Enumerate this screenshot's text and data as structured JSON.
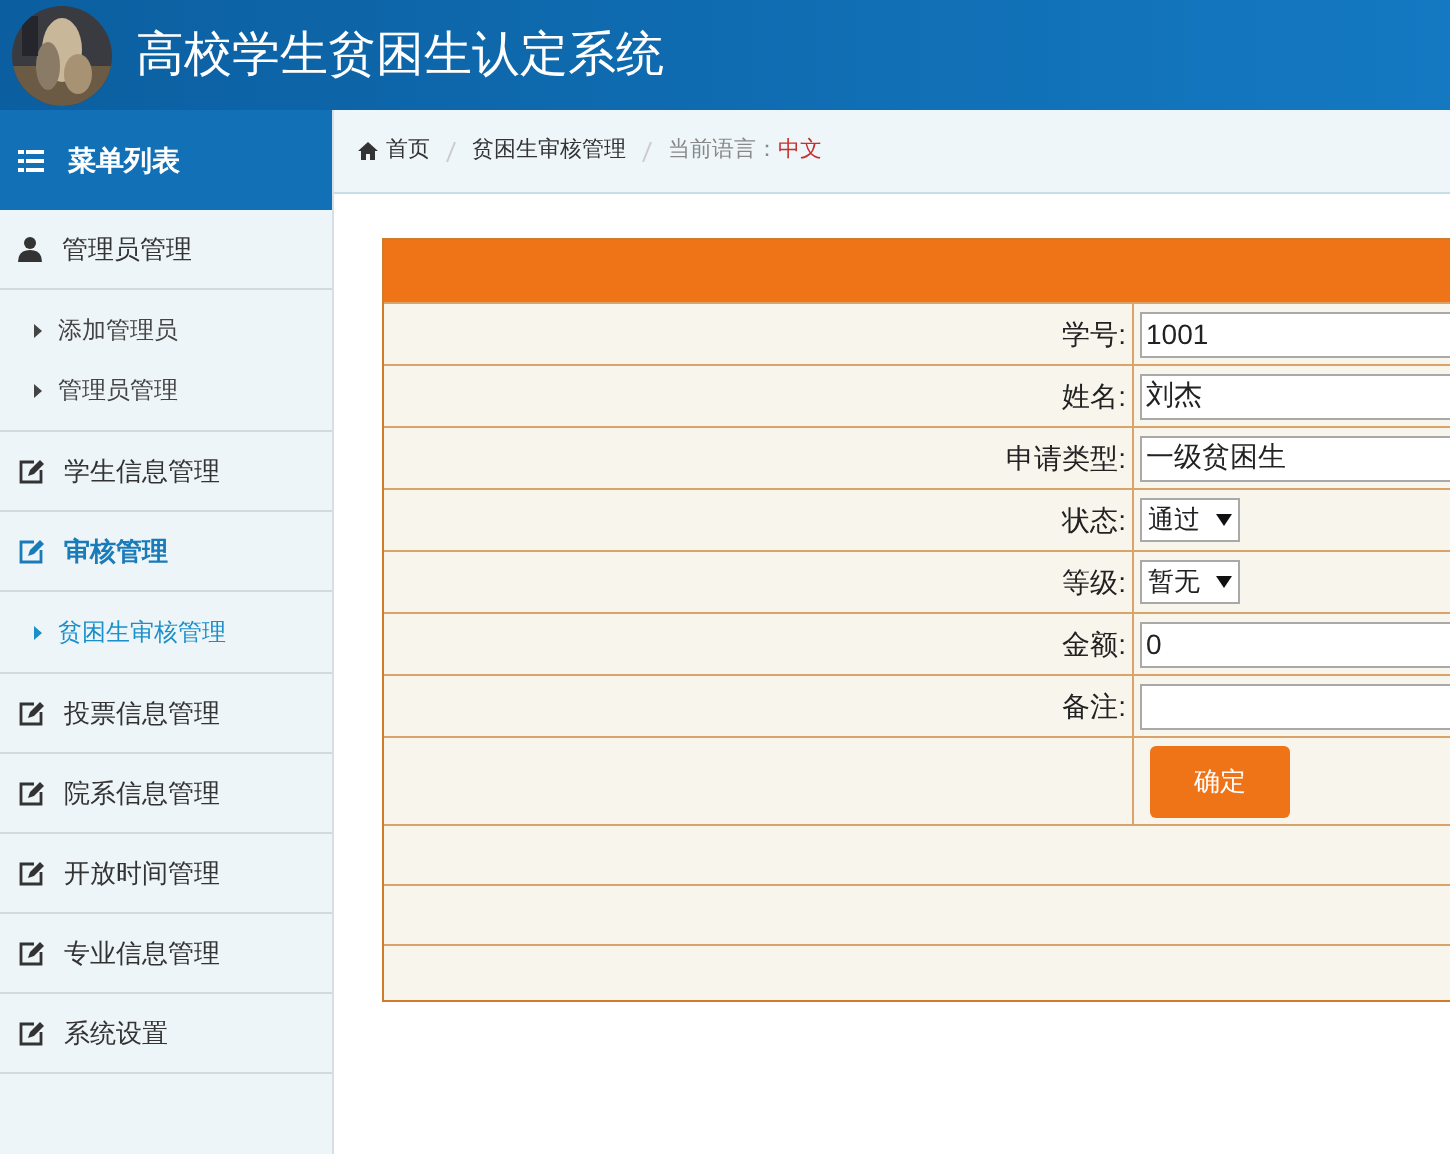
{
  "header": {
    "title": "高校学生贫困生认定系统"
  },
  "sidebar": {
    "title": "菜单列表",
    "items": [
      {
        "label": "管理员管理",
        "kind": "user",
        "selected": false,
        "children": [
          {
            "label": "添加管理员",
            "selected": false
          },
          {
            "label": "管理员管理",
            "selected": false
          }
        ]
      },
      {
        "label": "学生信息管理",
        "kind": "edit",
        "selected": false
      },
      {
        "label": "审核管理",
        "kind": "edit",
        "selected": true,
        "children": [
          {
            "label": "贫困生审核管理",
            "selected": true
          }
        ]
      },
      {
        "label": "投票信息管理",
        "kind": "edit",
        "selected": false
      },
      {
        "label": "院系信息管理",
        "kind": "edit",
        "selected": false
      },
      {
        "label": "开放时间管理",
        "kind": "edit",
        "selected": false
      },
      {
        "label": "专业信息管理",
        "kind": "edit",
        "selected": false
      },
      {
        "label": "系统设置",
        "kind": "edit",
        "selected": false
      }
    ]
  },
  "breadcrumb": {
    "home": "首页",
    "page": "贫困生审核管理",
    "language_label": "当前语言：",
    "language": "中文"
  },
  "form": {
    "fields": [
      {
        "kind": "text",
        "label": "学号:",
        "value": "1001"
      },
      {
        "kind": "text",
        "label": "姓名:",
        "value": "刘杰"
      },
      {
        "kind": "text",
        "label": "申请类型:",
        "value": "一级贫困生"
      },
      {
        "kind": "select",
        "label": "状态:",
        "value": "通过"
      },
      {
        "kind": "select",
        "label": "等级:",
        "value": "暂无"
      },
      {
        "kind": "text",
        "label": "金额:",
        "value": "0"
      },
      {
        "kind": "text",
        "label": "备注:"
      }
    ],
    "submit": "确定"
  }
}
